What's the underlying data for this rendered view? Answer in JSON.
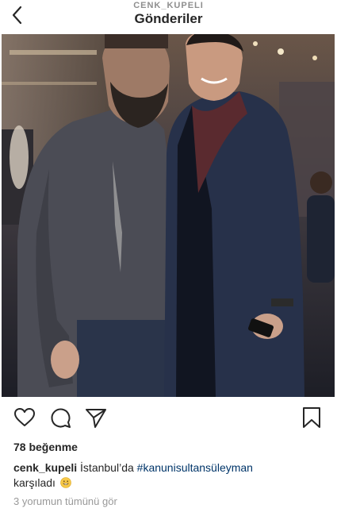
{
  "header": {
    "username": "CENK_KUPELI",
    "title": "Gönderiler",
    "back_icon": "chevron-left-icon"
  },
  "post": {
    "image_description_icon": "photo",
    "actions": {
      "like_icon": "heart-icon",
      "comment_icon": "comment-icon",
      "share_icon": "paper-plane-icon",
      "save_icon": "bookmark-icon"
    },
    "likes_text": "78 beğenme",
    "caption": {
      "username": "cenk_kupeli",
      "text_before": " İstanbul’da ",
      "hashtag": "#kanunisultansüleyman",
      "text_after": "karşıladı",
      "emoji": "grinning-face-emoji"
    },
    "view_comments_text": "3 yorumun tümünü gör"
  },
  "colors": {
    "hashtag": "#003569",
    "muted": "#999999",
    "text": "#262626"
  }
}
